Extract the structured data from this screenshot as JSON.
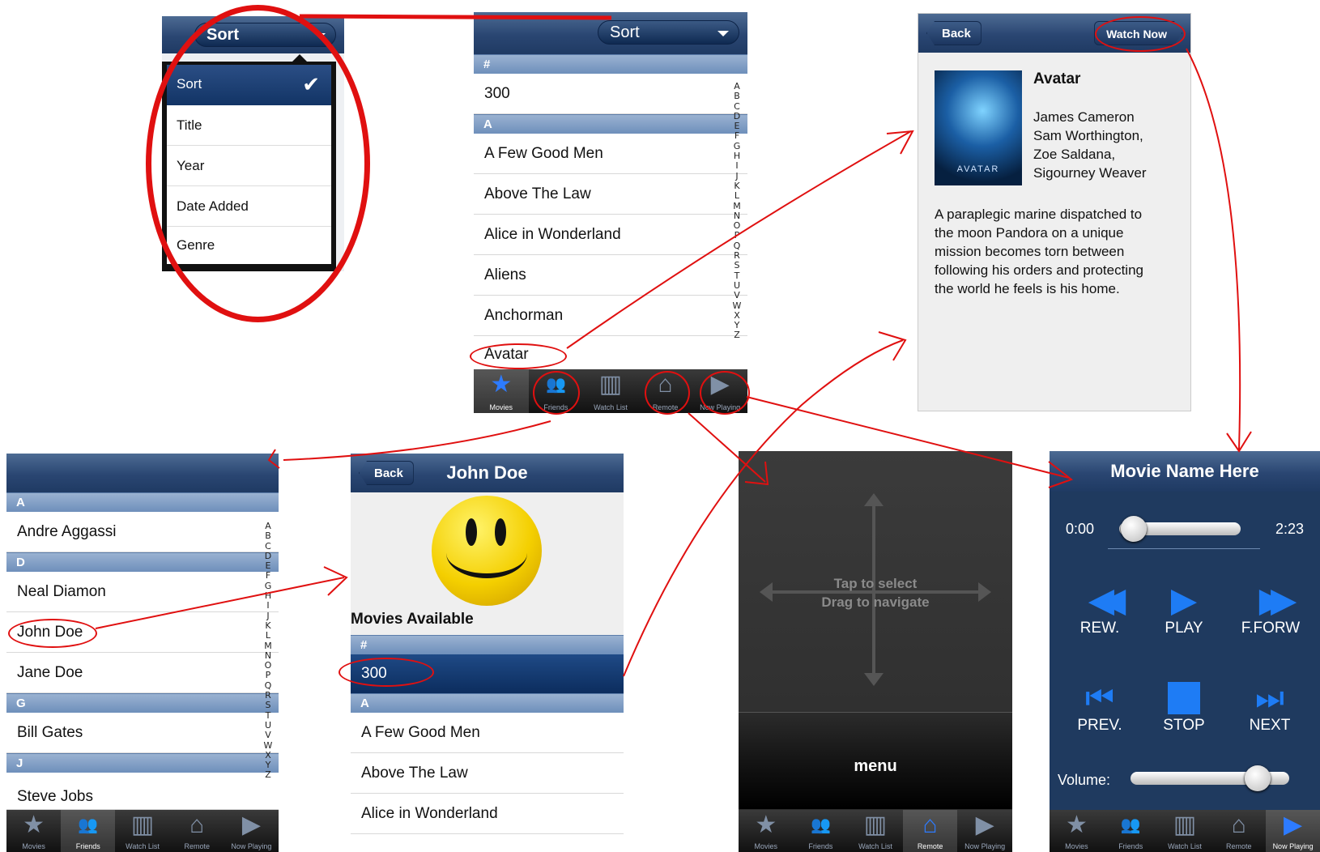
{
  "tabs": [
    "Movies",
    "Friends",
    "Watch List",
    "Remote",
    "Now Playing"
  ],
  "icons": {
    "movies": "star-icon",
    "friends": "people-icon",
    "watchlist": "book-icon",
    "remote": "house-icon",
    "nowplaying": "play-icon"
  },
  "sort_panel": {
    "select_label": "Sort",
    "options": [
      "Sort",
      "Title",
      "Year",
      "Date Added",
      "Genre"
    ],
    "selected": "Sort"
  },
  "movie_list": {
    "select_label": "Sort",
    "sections": [
      {
        "header": "#",
        "items": [
          "300"
        ]
      },
      {
        "header": "A",
        "items": [
          "A Few Good Men",
          "Above The Law",
          "Alice in Wonderland",
          "Aliens",
          "Anchorman",
          "Avatar"
        ]
      }
    ],
    "index": [
      "A",
      "B",
      "C",
      "D",
      "E",
      "F",
      "G",
      "H",
      "I",
      "J",
      "K",
      "L",
      "M",
      "N",
      "O",
      "P",
      "Q",
      "R",
      "S",
      "T",
      "U",
      "V",
      "W",
      "X",
      "Y",
      "Z"
    ]
  },
  "detail": {
    "back": "Back",
    "watch_now": "Watch Now",
    "title": "Avatar",
    "poster_text": "AVATAR",
    "cast": [
      "James Cameron",
      "Sam Worthington,",
      "Zoe Saldana,",
      "Sigourney Weaver"
    ],
    "description": [
      "A paraplegic marine dispatched to",
      "the moon Pandora on a unique",
      "mission becomes torn between",
      "following his orders and protecting",
      "the world he feels is his home."
    ]
  },
  "friends": {
    "sections": [
      {
        "header": "A",
        "items": [
          "Andre Aggassi"
        ]
      },
      {
        "header": "D",
        "items": [
          "Neal Diamon",
          "John Doe",
          "Jane Doe"
        ]
      },
      {
        "header": "G",
        "items": [
          "Bill Gates"
        ]
      },
      {
        "header": "J",
        "items": [
          "Steve Jobs"
        ]
      }
    ]
  },
  "friend_detail": {
    "back": "Back",
    "title": "John Doe",
    "movies_label": "Movies Available",
    "sections": [
      {
        "header": "#",
        "items": [
          "300"
        ]
      },
      {
        "header": "A",
        "items": [
          "A Few Good Men",
          "Above The Law",
          "Alice in Wonderland"
        ]
      }
    ]
  },
  "remote": {
    "line1": "Tap to select",
    "line2": "Drag to navigate",
    "menu": "menu"
  },
  "player": {
    "title": "Movie Name Here",
    "time_start": "0:00",
    "time_end": "2:23",
    "progress": 0.05,
    "volume": 0.8,
    "buttons": [
      "REW.",
      "PLAY",
      "F.FORW",
      "PREV.",
      "STOP",
      "NEXT"
    ],
    "volume_label": "Volume:"
  },
  "colors": {
    "accent_blue": "#1e7cf5",
    "nav_navy": "#2a4672",
    "annotation_red": "#e01010"
  }
}
